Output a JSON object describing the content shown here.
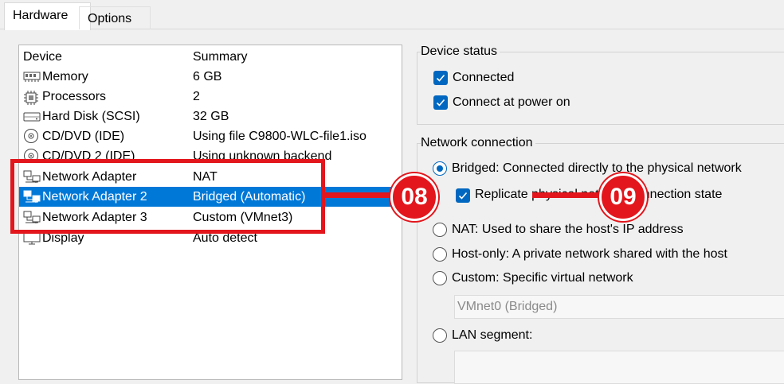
{
  "tabs": [
    {
      "label": "Hardware",
      "active": true
    },
    {
      "label": "Options",
      "active": false
    }
  ],
  "device_list": {
    "columns": [
      "Device",
      "Summary"
    ],
    "rows": [
      {
        "icon": "memory-icon",
        "device": "Memory",
        "summary": "6 GB"
      },
      {
        "icon": "processor-icon",
        "device": "Processors",
        "summary": "2"
      },
      {
        "icon": "hard-disk-icon",
        "device": "Hard Disk (SCSI)",
        "summary": "32 GB"
      },
      {
        "icon": "cd-dvd-icon",
        "device": "CD/DVD (IDE)",
        "summary": "Using file C9800-WLC-file1.iso"
      },
      {
        "icon": "cd-dvd-icon",
        "device": "CD/DVD 2 (IDE)",
        "summary": "Using unknown backend"
      },
      {
        "icon": "network-adapter-icon",
        "device": "Network Adapter",
        "summary": "NAT"
      },
      {
        "icon": "network-adapter-icon",
        "device": "Network Adapter 2",
        "summary": "Bridged (Automatic)",
        "selected": true
      },
      {
        "icon": "network-adapter-icon",
        "device": "Network Adapter 3",
        "summary": "Custom (VMnet3)"
      },
      {
        "icon": "display-icon",
        "device": "Display",
        "summary": "Auto detect"
      }
    ]
  },
  "device_status": {
    "title": "Device status",
    "connected": {
      "label": "Connected",
      "checked": true
    },
    "connect_at_power_on": {
      "label": "Connect at power on",
      "checked": true
    }
  },
  "network_connection": {
    "title": "Network connection",
    "bridged": {
      "label": "Bridged: Connected directly to the physical network",
      "selected": true
    },
    "replicate": {
      "label_start": "Replicate ",
      "label_hidden": "physical network",
      "label_end": " connection state",
      "checked": true
    },
    "nat": {
      "label": "NAT: Used to share the host's IP address",
      "selected": false
    },
    "host_only": {
      "label": "Host-only: A private network shared with the host",
      "selected": false
    },
    "custom": {
      "label": "Custom: Specific virtual network",
      "selected": false
    },
    "custom_network_value": "VMnet0 (Bridged)",
    "lan_segment": {
      "label": "LAN segment:",
      "selected": false
    }
  },
  "annotations": {
    "badge_1": "08",
    "badge_2": "09",
    "accent_color": "#e2161c"
  },
  "colors": {
    "selection": "#0078d7",
    "checkbox": "#0067c0"
  }
}
